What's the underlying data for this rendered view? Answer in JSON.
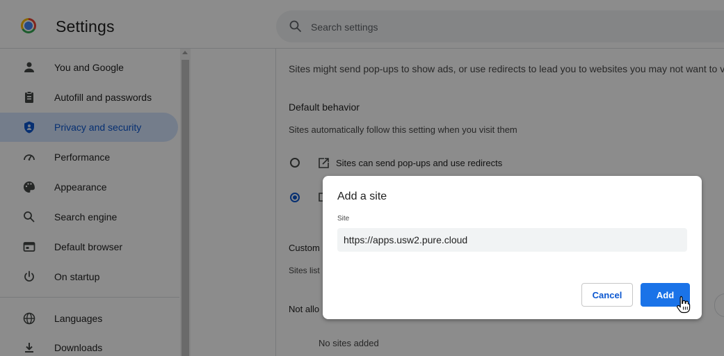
{
  "header": {
    "title": "Settings",
    "search": {
      "placeholder": "Search settings",
      "icon": "search-icon"
    }
  },
  "sidebar": {
    "items": [
      {
        "label": "You and Google",
        "icon": "person-icon",
        "active": false
      },
      {
        "label": "Autofill and passwords",
        "icon": "clipboard-icon",
        "active": false
      },
      {
        "label": "Privacy and security",
        "icon": "shield-icon",
        "active": true
      },
      {
        "label": "Performance",
        "icon": "speedometer-icon",
        "active": false
      },
      {
        "label": "Appearance",
        "icon": "palette-icon",
        "active": false
      },
      {
        "label": "Search engine",
        "icon": "search-icon",
        "active": false
      },
      {
        "label": "Default browser",
        "icon": "browser-icon",
        "active": false
      },
      {
        "label": "On startup",
        "icon": "power-icon",
        "active": false
      },
      {
        "label": "Languages",
        "icon": "globe-icon",
        "active": false
      },
      {
        "label": "Downloads",
        "icon": "download-icon",
        "active": false
      }
    ]
  },
  "main": {
    "intro": "Sites might send pop-ups to show ads, or use redirects to lead you to websites you may not want to vi",
    "default_behavior": {
      "heading": "Default behavior",
      "sub": "Sites automatically follow this setting when you visit them",
      "option_allow": "Sites can send pop-ups and use redirects"
    },
    "customized": {
      "heading": "Custom",
      "sub": "Sites list"
    },
    "not_allowed": {
      "label": "Not allo",
      "empty": "No sites added"
    }
  },
  "dialog": {
    "title": "Add a site",
    "field_label": "Site",
    "site_value": "https://apps.usw2.pure.cloud",
    "cancel_label": "Cancel",
    "add_label": "Add"
  },
  "colors": {
    "accent": "#0b57d0",
    "active_nav_bg": "#d3e3fd",
    "add_button": "#1a73e8"
  }
}
